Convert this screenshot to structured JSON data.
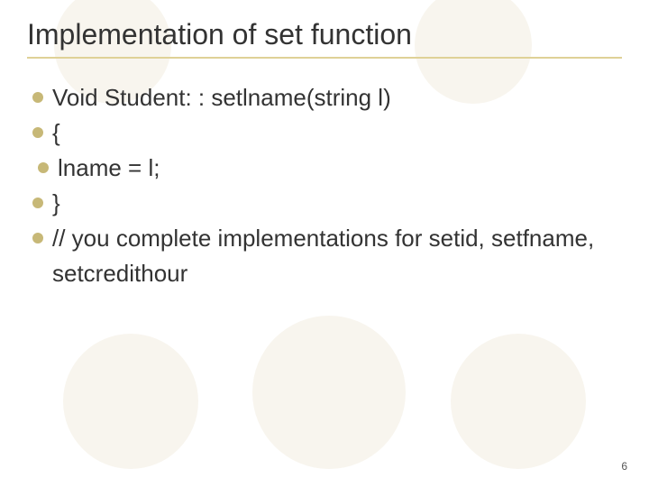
{
  "title": "Implementation of set function",
  "lines": [
    "Void  Student: : setlname(string l)",
    "{",
    " lname = l;",
    "}",
    "// you complete implementations for setid, setfname, setcredithour"
  ],
  "page_number": "6"
}
